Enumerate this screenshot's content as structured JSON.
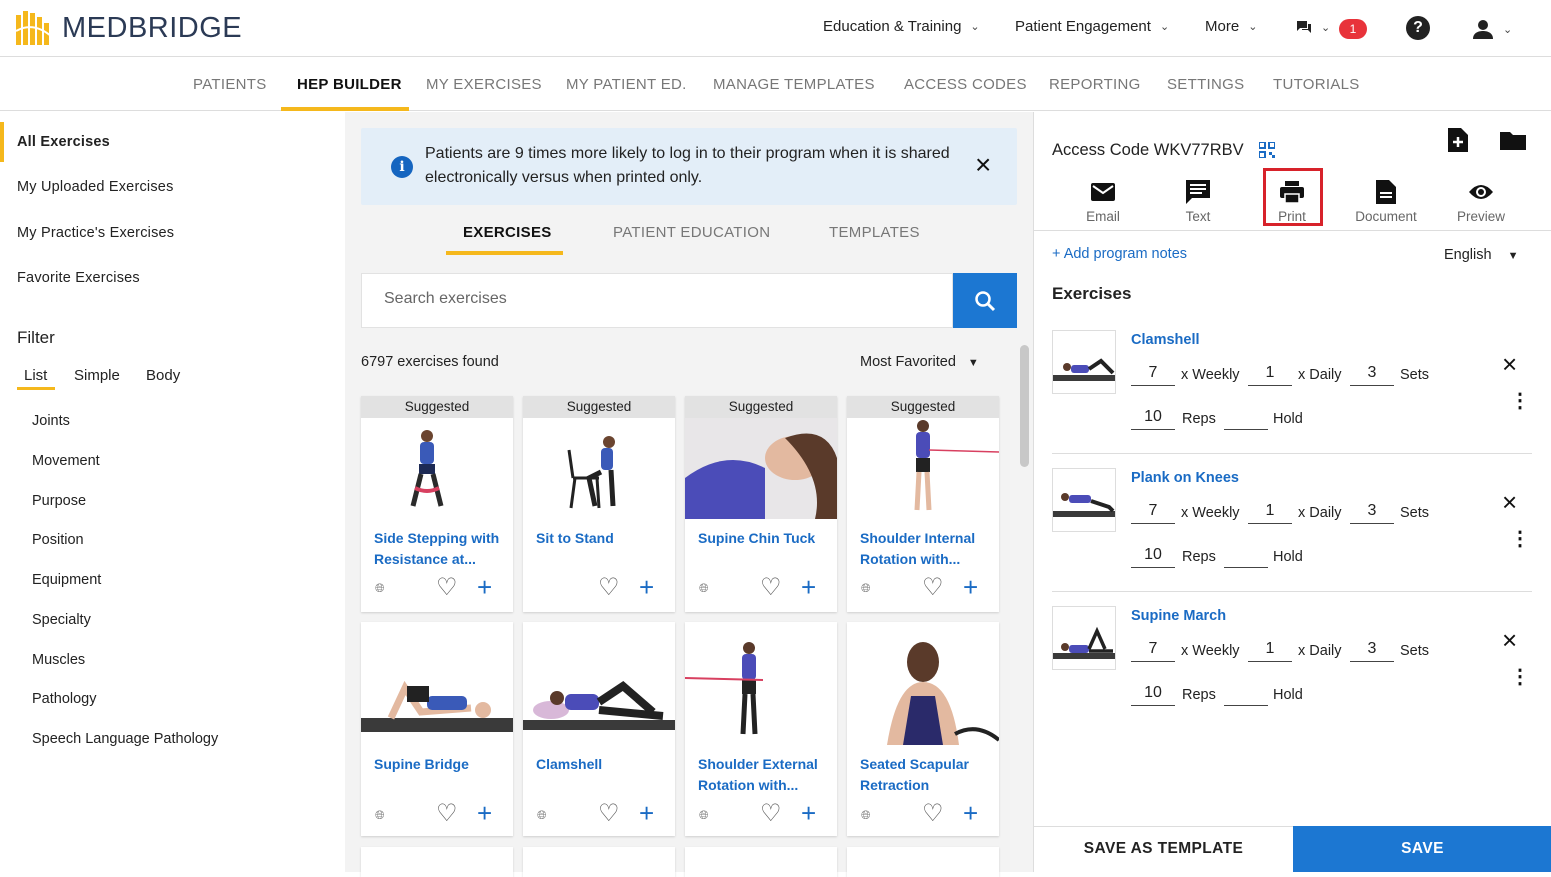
{
  "brand": {
    "name": "MEDBRIDGE"
  },
  "topnav": {
    "items": [
      "Education & Training",
      "Patient Engagement",
      "More"
    ],
    "notification_count": "1",
    "help_label": "?"
  },
  "secnav": {
    "items": [
      "PATIENTS",
      "HEP BUILDER",
      "MY EXERCISES",
      "MY PATIENT ED.",
      "MANAGE TEMPLATES",
      "ACCESS CODES",
      "REPORTING",
      "SETTINGS",
      "TUTORIALS"
    ],
    "active": "HEP BUILDER"
  },
  "sidebar": {
    "items": [
      "All Exercises",
      "My Uploaded Exercises",
      "My Practice's Exercises",
      "Favorite Exercises"
    ],
    "filter_title": "Filter",
    "filter_tabs": [
      "List",
      "Simple",
      "Body"
    ],
    "filter_items": [
      "Joints",
      "Movement",
      "Purpose",
      "Position",
      "Equipment",
      "Specialty",
      "Muscles",
      "Pathology",
      "Speech Language Pathology"
    ]
  },
  "banner": {
    "text": "Patients are 9 times more likely to log in to their program when it is shared electronically versus when printed only.",
    "info_glyph": "i",
    "close_glyph": "×"
  },
  "content_tabs": [
    "EXERCISES",
    "PATIENT EDUCATION",
    "TEMPLATES"
  ],
  "search": {
    "placeholder": "Search exercises"
  },
  "results": {
    "count": "6797 exercises found",
    "sort": "Most Favorited"
  },
  "cards": [
    {
      "head": "Suggested",
      "title": "Side Stepping with Resistance at...",
      "globe": true
    },
    {
      "head": "Suggested",
      "title": "Sit to Stand",
      "globe": false
    },
    {
      "head": "Suggested",
      "title": "Supine Chin Tuck",
      "globe": true
    },
    {
      "head": "Suggested",
      "title": "Shoulder Internal Rotation with...",
      "globe": true
    },
    {
      "head": "",
      "title": "Supine Bridge",
      "globe": true
    },
    {
      "head": "",
      "title": "Clamshell",
      "globe": true
    },
    {
      "head": "",
      "title": "Shoulder External Rotation with...",
      "globe": true
    },
    {
      "head": "",
      "title": "Seated Scapular Retraction",
      "globe": true
    }
  ],
  "program": {
    "access_code": "Access Code WKV77RBV",
    "actions": [
      "Email",
      "Text",
      "Print",
      "Document",
      "Preview"
    ],
    "add_notes": "+ Add program notes",
    "language": "English",
    "exercises_title": "Exercises",
    "exercises": [
      {
        "name": "Clamshell",
        "weekly": "7",
        "daily": "1",
        "sets": "3",
        "reps": "10",
        "hold": ""
      },
      {
        "name": "Plank on Knees",
        "weekly": "7",
        "daily": "1",
        "sets": "3",
        "reps": "10",
        "hold": ""
      },
      {
        "name": "Supine March",
        "weekly": "7",
        "daily": "1",
        "sets": "3",
        "reps": "10",
        "hold": ""
      }
    ],
    "labels": {
      "weekly": "x Weekly",
      "daily": "x Daily",
      "sets": "Sets",
      "reps": "Reps",
      "hold": "Hold"
    },
    "save_template": "SAVE AS TEMPLATE",
    "save": "SAVE"
  },
  "colors": {
    "accent": "#f5b81c",
    "primary": "#1c77d2",
    "link": "#1a6bc4",
    "highlight": "#d7222a"
  }
}
